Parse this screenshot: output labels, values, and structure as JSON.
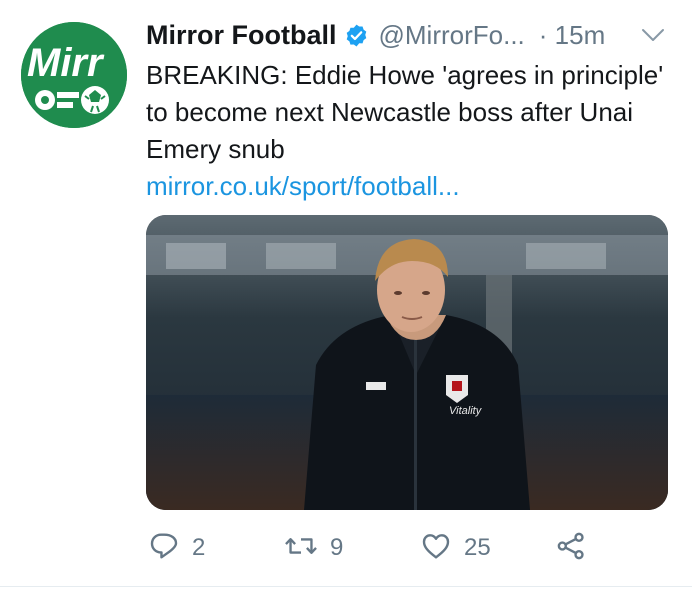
{
  "tweet": {
    "author_name": "Mirror Football",
    "handle": "@MirrorFo...",
    "timestamp": "· 15m",
    "text": "BREAKING: Eddie Howe 'agrees in principle' to become next Newcastle boss after Unai Emery snub",
    "link": "mirror.co.uk/sport/football...",
    "avatar_icon": "mirror-football-logo",
    "avatar_logo_text": "Mirr",
    "media_icon": "photo-eddie-howe",
    "media_badge_text": "Vitality",
    "verified_icon": "verified-badge-icon",
    "menu_icon": "chevron-down-icon"
  },
  "actions": {
    "reply_count": "2",
    "retweet_count": "9",
    "like_count": "25",
    "reply_icon": "reply-icon",
    "retweet_icon": "retweet-icon",
    "like_icon": "heart-icon",
    "share_icon": "share-icon"
  },
  "colors": {
    "brand_green": "#1f8c4e",
    "link_blue": "#1b95e0",
    "verified_blue": "#1da1f2",
    "muted_gray": "#657786",
    "text": "#14171a"
  }
}
